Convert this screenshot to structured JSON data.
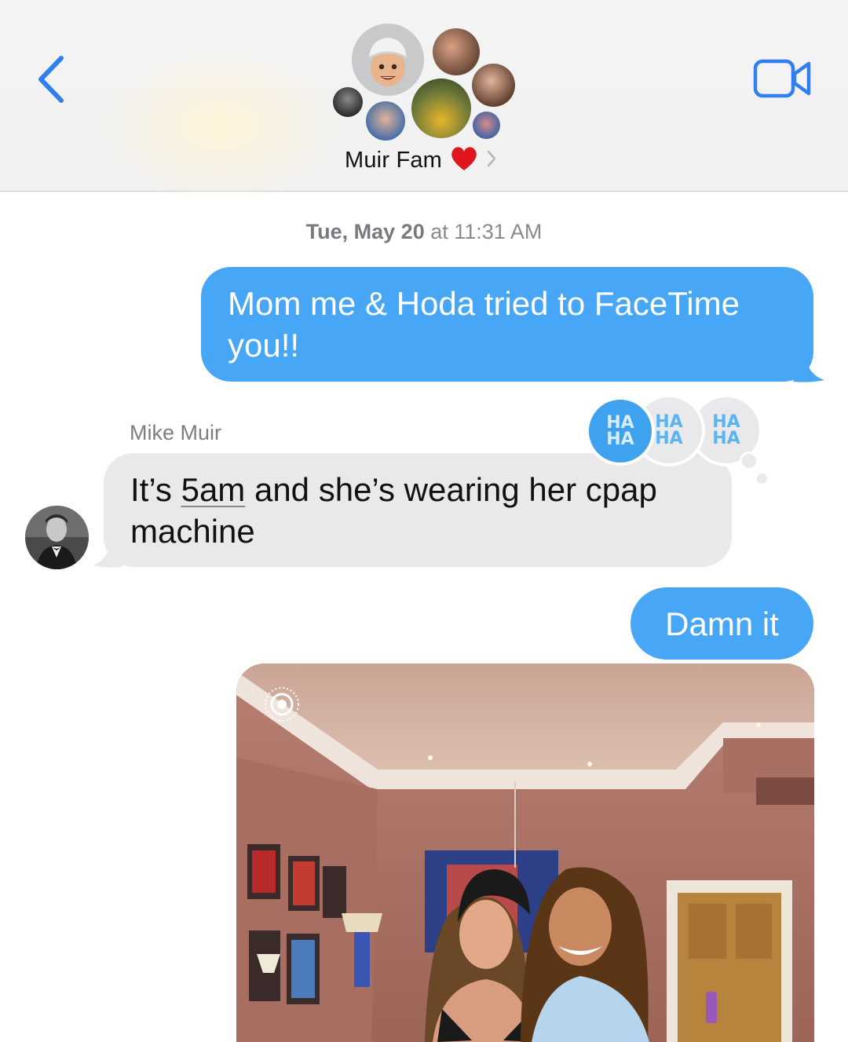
{
  "header": {
    "group_name": "Muir Fam",
    "heart_emoji": "❤️",
    "back_icon": "chevron-left-icon",
    "video_icon": "video-camera-icon",
    "accent_color": "#2f7ff0"
  },
  "thread": {
    "timestamp_day": "Tue, May 20",
    "timestamp_at": " at ",
    "timestamp_time": "11:31 AM",
    "messages": [
      {
        "from": "me",
        "text": "Mom me & Hoda tried to FaceTime you!!"
      },
      {
        "from": "Mike Muir",
        "sender_label": "Mike Muir",
        "text_pre": "It’s ",
        "text_link": "5am",
        "text_post": " and she’s wearing her cpap machine",
        "tapback": "HA HA"
      },
      {
        "from": "me",
        "text": "Damn it"
      }
    ],
    "tapbacks": [
      {
        "line1": "HA",
        "line2": "HA"
      },
      {
        "line1": "HA",
        "line2": "HA"
      },
      {
        "line1": "HA",
        "line2": "HA"
      }
    ]
  },
  "colors": {
    "outgoing_bubble": "#47a6f5",
    "incoming_bubble": "#e9e9eb"
  }
}
